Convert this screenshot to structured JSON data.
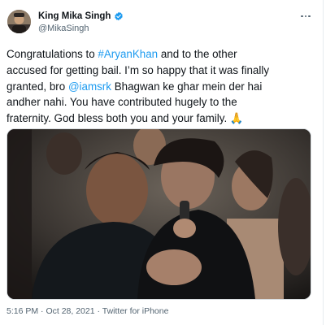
{
  "author": {
    "name": "King Mika Singh",
    "handle": "@MikaSingh"
  },
  "tweet": {
    "line1_pre": "Congratulations to ",
    "hashtag": "#AryanKhan",
    "line1_post": " and to the other",
    "line2": "accused for getting bail. I’m so happy that it was finally",
    "line3_pre": "granted, bro ",
    "mention": "@iamsrk",
    "line3_post": " Bhagwan ke ghar mein der hai",
    "line4": "andher nahi. You have contributed hugely to the",
    "line5": "fraternity. God bless both you and your family. 🙏"
  },
  "meta": {
    "time": "5:16 PM",
    "separator1": " · ",
    "date": "Oct 28, 2021",
    "separator2": " · ",
    "source": "Twitter for iPhone"
  },
  "colors": {
    "link": "#1d9bf0",
    "verified": "#1d9bf0",
    "text": "#0f1419",
    "muted": "#536471"
  },
  "icons": {
    "verified": "verified-badge-icon",
    "more": "more-icon"
  }
}
